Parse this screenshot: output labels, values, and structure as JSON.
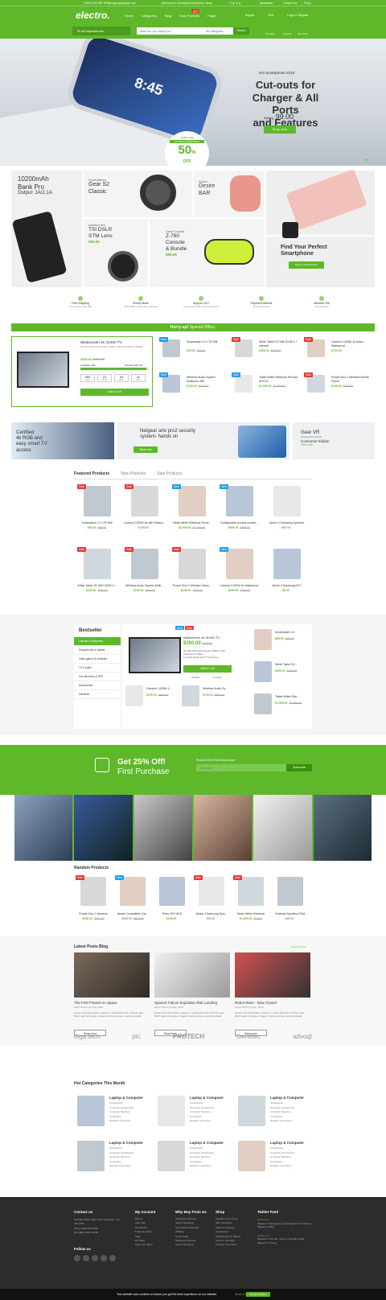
{
  "header": {
    "phone": "(+800) 344 957 8999",
    "email": "company@gmail.com",
    "welcome": "Welcome to Worldwide Electronics Store",
    "lang": "English",
    "currency": "USD",
    "newsletter": "Newsletter",
    "contact": "Contact Us",
    "faq": "FAQs",
    "logo": "electro.",
    "nav": [
      "Home",
      "Categories",
      "Blog",
      "Sale Products",
      "Pages"
    ],
    "hot": "HOT",
    "account": "Login or Register",
    "departments": "All Departments",
    "search_placeholder": "What are you looking for?",
    "all_categories": "All Categories",
    "search_btn": "Search",
    "compare": "Compare",
    "favorite": "Favorite",
    "cart": "Your Cart",
    "cart_count": "0"
  },
  "hero": {
    "kicker": "Hot Smartphone 2018",
    "title1": "Cut-outs for",
    "title2": "Charger & All Ports",
    "title3": "and Features",
    "starting": "Starting",
    "price": "99.00",
    "btn": "Shop Now",
    "badge_top": "Online deal",
    "badge_mid": "FLOWING DOWN SALE",
    "badge_pct": "50",
    "badge_off": "OFF",
    "badge_disc": "Discounts",
    "phone_time": "8:45"
  },
  "promos": {
    "powerbank_t1": "10200mAh",
    "powerbank_t2": "Bank Pro",
    "powerbank_t3": "Output: 1A/2.1A",
    "gear_k": "Smartwatches",
    "gear_t1": "Gear S2",
    "gear_t2": "Classic",
    "desire_k": "Audios",
    "desire_t1": "Desire",
    "desire_t2": "BAR",
    "lens_k": "Camera Lens",
    "lens_t1": "TSI DSLR",
    "lens_t2": "STM Lens",
    "lens_price": "$60.00",
    "z760_k": "Game Console",
    "z760_t1": "Z-760",
    "z760_t2": "Console",
    "z760_t3": "& Bundle",
    "z760_price": "$99.99",
    "phone_t1": "Find Your Perfect",
    "phone_t2": "Smartphone",
    "phone_btn": "Explore Smartphone"
  },
  "features": [
    {
      "t": "Free Shipping",
      "s": "On all orders over $99"
    },
    {
      "t": "Money Back",
      "s": "100% Safe money back guarantee"
    },
    {
      "t": "Support 24/7",
      "s": "Get in touch with customer support"
    },
    {
      "t": "Payment Method",
      "s": "Secure Payment"
    },
    {
      "t": "Member Gift",
      "s": "Get great gifts"
    }
  ],
  "hurry": {
    "title1": "Hurry up!",
    "title2": "Special Offers."
  },
  "deal": {
    "name": "Widescreen 4K SUHD TV",
    "desc": "4K with HD Touch Screen (1280 x 720) Android 4.4 (Kitkat)",
    "price": "$350.00",
    "old": "$400.00",
    "available": "Available: 891",
    "sold": "Already Sold: 28",
    "timer": [
      "550",
      "21",
      "53",
      "42"
    ],
    "timer_labels": [
      "Days",
      "Hours",
      "Mins",
      "Secs"
    ],
    "btn": "Add to Cart"
  },
  "special": [
    {
      "name": "Smartwatch 2.0 LTE Wifi",
      "price": "$55.00",
      "old": "$99.00",
      "tag": "New"
    },
    {
      "name": "White Tablet S2 Wifi 32GB 9.7 Internet",
      "price": "$455.00",
      "old": "$999.00",
      "tag": "Sale"
    },
    {
      "name": "Camera C430W 4k Action Waterproof",
      "price": "$799.00",
      "old": "",
      "tag": "Sale"
    },
    {
      "name": "Wireless Audio System Multiroom 360",
      "price": "$799.00",
      "old": "$799.00",
      "tag": "New"
    },
    {
      "name": "Tablet White Elitebook Revolve 810 G2",
      "price": "$1,599.00",
      "old": "$1,999.00",
      "tag": "New"
    },
    {
      "name": "Purple Solo 2 Wireless Mobile Phone",
      "price": "$248.99",
      "old": "$298.00",
      "tag": "Sale"
    }
  ],
  "banners": {
    "b1_t1": "Certified",
    "b1_t2": "4k RGB and",
    "b1_t3": "easy smart TV",
    "b1_t4": "access",
    "b2_t1": "Netgear arlo pro2 security",
    "b2_t2": "system- hands on",
    "b2_btn": "Shop now",
    "b3_t1": "Gear VR",
    "b3_t2": "Powered by Oculus",
    "b3_t3": "Consumer Edition",
    "b3_btn": "View now"
  },
  "tabs": [
    "Featured Products",
    "New Products",
    "Sale Products"
  ],
  "featured": [
    {
      "name": "Smartwatch 2.0 LTE Wifi",
      "price": "$55.00",
      "old": "$99.00",
      "tag": "Sale"
    },
    {
      "name": "Camera C430W 4k with Waterp...",
      "price": "$799.00",
      "old": "",
      "tag": "Sale"
    },
    {
      "name": "Tablet White Elitebook Revol...",
      "price": "$1,999.00",
      "old": "$2,299.00",
      "tag": "New"
    },
    {
      "name": "Configurable product include...",
      "price": "$999.00",
      "old": "$999.00",
      "tag": "New"
    },
    {
      "name": "Aimiel 3 Samsung Symbian",
      "price": "$99.00",
      "old": "",
      "tag": ""
    },
    {
      "name": "White Tablet S2 WiFi 32GB 9...",
      "price": "$499.00",
      "old": "$999.00",
      "tag": "Sale"
    },
    {
      "name": "Wireless Audio System Multi...",
      "price": "$799.00",
      "old": "$999.00",
      "tag": "Sale"
    },
    {
      "name": "Purple Solo 2 Wireless Head...",
      "price": "$248.00",
      "old": "$298.00",
      "tag": "Sale"
    },
    {
      "name": "Camera C430W 4k Waterproof",
      "price": "$699.00",
      "old": "$799.00",
      "tag": "New"
    },
    {
      "name": "Aimiel 3 Samsung NTC",
      "price": "$5.00",
      "old": "",
      "tag": ""
    }
  ],
  "bestseller": {
    "title": "Bestseller",
    "cats": [
      "Laptops & computers",
      "Smartphones & tablets",
      "Video games & consoles",
      "TV & audio",
      "Car electronic & GPS",
      "Accessories",
      "Cameras"
    ],
    "main_name": "Widescreen 4k SUHD TV",
    "main_price": "$350.00",
    "main_old": "$400.00",
    "main_desc": [
      "4K with HD Touch Screen (1280 x 720)",
      "Android 4.4 Kitkat",
      "1.4 GHz Quad Core™ Processor"
    ],
    "main_btn": "Add to Cart",
    "wishlist": "Wishlist",
    "compare": "Compare",
    "items": [
      {
        "name": "Smartwatch 2.0",
        "price": "$55.00",
        "old": "$99.00"
      },
      {
        "name": "White Tablet S2...",
        "price": "$455.00",
        "old": "$999.00"
      },
      {
        "name": "Camera C430W 4...",
        "price": "$799.00",
        "old": "$999.00"
      },
      {
        "name": "Wireless Audio Sy...",
        "price": "$799.00",
        "old": "$999.00"
      },
      {
        "name": "Tablet White Elite...",
        "price": "$1,599.00",
        "old": "$1,999.00"
      }
    ]
  },
  "discount": {
    "t1": "Get 25% Off!",
    "t2": "First Purchase",
    "label": "Receive 25% Off for first purchase",
    "placeholder": "Your email",
    "btn": "Subscribe"
  },
  "random": {
    "title": "Random Products",
    "items": [
      {
        "name": "Purple Solo 2 Wireless",
        "price": "$248.00",
        "old": "$298.00",
        "tag": "Sale"
      },
      {
        "name": "Abarth Compatible Car...",
        "price": "$499.00",
        "old": "$599.00",
        "tag": "New"
      },
      {
        "name": "Retro XNT 95 E",
        "price": "$199.00",
        "old": "",
        "tag": ""
      },
      {
        "name": "Aimiel 3 Samsung Sym...",
        "price": "$99.00",
        "old": "",
        "tag": "Sale"
      },
      {
        "name": "Tablet White Elitebook",
        "price": "$1,599.00",
        "old": "$2,000",
        "tag": "Sale"
      },
      {
        "name": "Earbuds Sportbud 2016",
        "price": "$99.00",
        "old": "",
        "tag": ""
      }
    ]
  },
  "blog": {
    "title": "Latest Posts Blog",
    "all": "View All Posts",
    "posts": [
      {
        "title": "The First Flowers In Space",
        "meta": "Admin Admin   30 Nov, 2021",
        "text": "Donec commodo finibus massa, in malesuada arcu tincidunt quis. Morbi eget nisl augue. Integer rhoncus posuere sed consequat.",
        "btn": "Read more"
      },
      {
        "title": "SpaceX Falcon Explodes After Landing",
        "meta": "Huyen Pham   14 Sep, 2019",
        "text": "Donec commodo finibus massa, in malesuada arcu tincidunt quis. Morbi eget nisl augue. Integer rhoncus posuere sed consequat.",
        "btn": "Read more"
      },
      {
        "title": "Robot Wars - Now Closed",
        "meta": "Huyen Pham   14 Jun, 2019",
        "text": "Donec commodo finibus massa, in malesuada arcu tincidunt quis. Morbi eget nisl augue. Integer rhoncus posuere sed consequat.",
        "btn": "Read more"
      }
    ]
  },
  "brands": [
    "diga.tech",
    "ptc",
    "PROTECH",
    "Genetec",
    "advoqt"
  ],
  "hot": {
    "title": "Hot Categories This Month",
    "cat_title": "Laptop & Computer",
    "subs": [
      "Accessories",
      "Computer Accessories",
      "Computer Monitors",
      "Computers",
      "Desktop Computers"
    ]
  },
  "footer": {
    "contact": "Contact us",
    "address": "55 Bdan Street, Bdan Court #15 Robo, Syn 780-2780",
    "phone": "Phone:(080) 246-8910",
    "fax": "Fax:(080) 2455-13768",
    "follow": "Follow us",
    "cols": [
      {
        "t": "My Account",
        "items": [
          "Sign in",
          "View Cart",
          "My Wishlist",
          "Track My Order",
          "Help",
          "Our Blog",
          "About Our Shop"
        ]
      },
      {
        "t": "Why Buy From Us",
        "items": [
          "Shipping & Returns",
          "Secure Shopping",
          "International Shipping",
          "Affiliates",
          "Group Sales",
          "Shipping & Returns",
          "Secure Shopping"
        ]
      },
      {
        "t": "Shop",
        "items": [
          "Laptops & computers",
          "Mac computers",
          "Video & Consoles",
          "Accessories",
          "Smartphones & Tablets",
          "Game & Consoles",
          "Desktop Computers"
        ]
      }
    ],
    "twitter": "Twitter Feed",
    "tweet_user": "electromex",
    "tweet1": "Magento 2 Developer (Latest Magento 2.3 Theme) Magento 2 Blog",
    "tweet2": "Magento 2 Tutorial - How to manually install Magento 2 Theme",
    "cookie": "This website uses cookies to ensure you get the best experience on our website.",
    "cookie_more": "Read more",
    "cookie_btn": "Accept Cookies"
  }
}
